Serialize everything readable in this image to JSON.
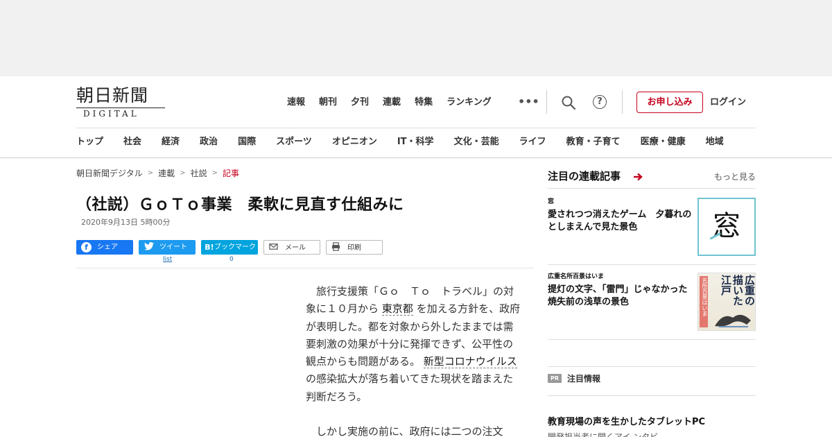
{
  "header": {
    "logo_jp": "朝日新聞",
    "logo_en": "DIGITAL",
    "topnav": [
      "速報",
      "朝刊",
      "夕刊",
      "連載",
      "特集",
      "ランキング"
    ],
    "subscribe_label": "お申し込み",
    "login_label": "ログイン",
    "help_glyph": "?"
  },
  "categories": [
    "トップ",
    "社会",
    "経済",
    "政治",
    "国際",
    "スポーツ",
    "オピニオン",
    "IT・科学",
    "文化・芸能",
    "ライフ",
    "教育・子育て",
    "医療・健康",
    "地域"
  ],
  "breadcrumb": [
    "朝日新聞デジタル",
    "連載",
    "社説",
    "記事"
  ],
  "article": {
    "headline": "（社説）ＧｏＴｏ事業　柔軟に見直す仕組みに",
    "date": "2020年9月13日 5時00分",
    "share": {
      "facebook": "シェア",
      "twitter": "ツイート",
      "hatena": "ブックマーク",
      "hatena_logo": "B!",
      "mail": "メール",
      "print": "印刷",
      "twitter_count": "list",
      "hatena_count": "0"
    },
    "p1_a": "　旅行支援策「Ｇｏ　Ｔｏ　トラベル」の対象に１０月から",
    "p1_link1": "東京都",
    "p1_b": "を加える方針を、政府が表明した。都を対象から外したままでは需要刺激の効果が十分に発揮できず、公平性の観点からも問題がある。",
    "p1_link2": "新型コロナウイルス",
    "p1_c": "の感染拡大が落ち着いてきた現状を踏まえた判断だろう。",
    "p2": "　しかし実施の前に、政府には二つの注文"
  },
  "sidebar": {
    "title": "注目の連載記事",
    "more": "もっと見る",
    "items": [
      {
        "kicker": "窓",
        "title": "愛されつつ消えたゲーム　夕暮れのとしまえんで見た景色",
        "thumb_char": "窓"
      },
      {
        "kicker": "広重名所百景はいま",
        "title": "提灯の文字、「雷門」じゃなかった　焼失前の浅草の景色",
        "thumb_text": "広重の描いた江戸",
        "thumb_side": "名所百景はいま"
      }
    ],
    "pr_badge": "PR",
    "pr_label": "注目情報",
    "pr_title": "教育現場の声を生かしたタブレットPC",
    "pr_sub": "開発担当者に聞くアイ ンタビ"
  },
  "colors": {
    "accent_red": "#c4001d",
    "facebook": "#1877f2",
    "twitter": "#1d9bf0",
    "hatena": "#00a4de"
  }
}
